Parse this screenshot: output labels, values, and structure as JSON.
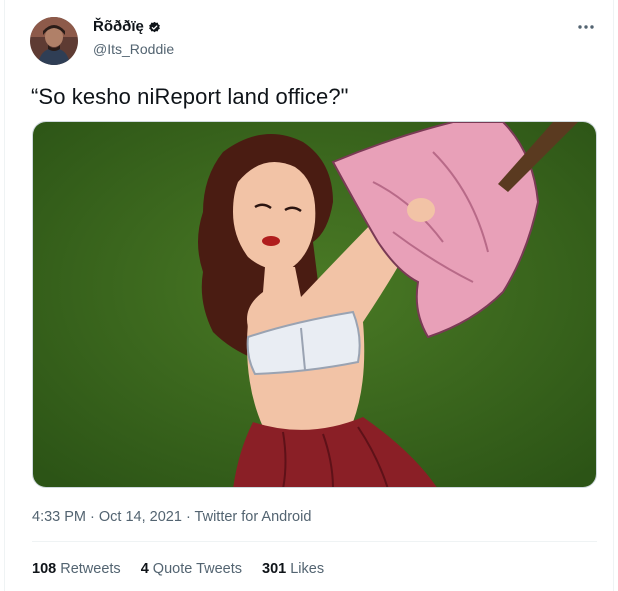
{
  "author": {
    "display_name": "Řõððïę",
    "handle": "@Its_Roddie",
    "verified": true,
    "avatar_icon": "profile-photo"
  },
  "menu": {
    "icon": "more-options-icon",
    "glyph": "···"
  },
  "tweet": {
    "text": "“So kesho niReport land office?\"",
    "media_alt": "illustration"
  },
  "metadata": {
    "time": "4:33 PM",
    "separator_1": " · ",
    "date": "Oct 14, 2021",
    "separator_2": " · ",
    "source": "Twitter for Android"
  },
  "stats": [
    {
      "count": "108",
      "label": "Retweets"
    },
    {
      "count": "4",
      "label": "Quote Tweets"
    },
    {
      "count": "301",
      "label": "Likes"
    }
  ],
  "colors": {
    "text_primary": "#0f1419",
    "text_secondary": "#536471",
    "divider": "#eff3f4",
    "media_background": "#3c6b1e"
  }
}
